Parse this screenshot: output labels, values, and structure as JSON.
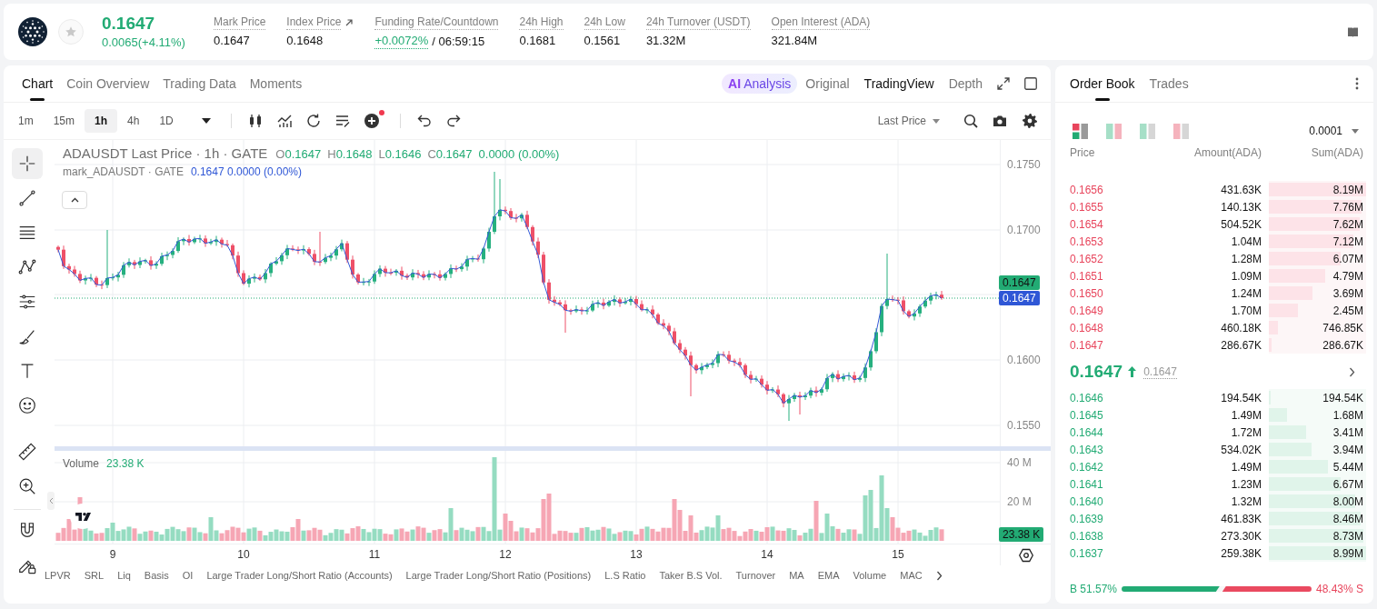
{
  "header": {
    "price": "0.1647",
    "change": "0.0065(+4.11%)",
    "favorite": false,
    "stats": [
      {
        "label": "Mark Price",
        "value": "0.1647",
        "kind": "plain"
      },
      {
        "label": "Index Price",
        "value": "0.1648",
        "kind": "link"
      },
      {
        "label": "Funding Rate/Countdown",
        "value": "+0.0072%",
        "countdown": "/ 06:59:15",
        "kind": "funding"
      },
      {
        "label": "24h High",
        "value": "0.1681",
        "kind": "plain"
      },
      {
        "label": "24h Low",
        "value": "0.1561",
        "kind": "plain"
      },
      {
        "label": "24h Turnover (USDT)",
        "value": "31.32M",
        "kind": "plain"
      },
      {
        "label": "Open Interest (ADA)",
        "value": "321.84M",
        "kind": "plain"
      }
    ]
  },
  "chart_panel": {
    "tabs": [
      {
        "label": "Chart",
        "selected": true
      },
      {
        "label": "Coin Overview",
        "selected": false
      },
      {
        "label": "Trading Data",
        "selected": false
      },
      {
        "label": "Moments",
        "selected": false
      }
    ],
    "views": [
      {
        "badge": "AI",
        "label": "Analysis",
        "kind": "ai",
        "selected": false
      },
      {
        "label": "Original",
        "kind": "plain",
        "selected": false
      },
      {
        "label": "TradingView",
        "kind": "plain",
        "selected": true
      },
      {
        "label": "Depth",
        "kind": "plain",
        "selected": false
      }
    ],
    "intervals": [
      {
        "label": "1m",
        "selected": false
      },
      {
        "label": "15m",
        "selected": false
      },
      {
        "label": "1h",
        "selected": true
      },
      {
        "label": "4h",
        "selected": false
      },
      {
        "label": "1D",
        "selected": false
      }
    ],
    "add_indicator_dot": true,
    "price_source": "Last Price",
    "tool_groups": [
      [
        {
          "kind": "crosshair",
          "selected": true
        },
        {
          "kind": "trend-line",
          "selected": false
        },
        {
          "kind": "horizontal-lines",
          "selected": false
        },
        {
          "kind": "pattern",
          "selected": false
        },
        {
          "kind": "levels",
          "selected": false
        },
        {
          "kind": "brush",
          "selected": false
        },
        {
          "kind": "text",
          "selected": false
        },
        {
          "kind": "emoji",
          "selected": false
        }
      ],
      [
        {
          "kind": "ruler",
          "selected": false
        },
        {
          "kind": "zoom",
          "selected": false
        }
      ],
      [
        {
          "kind": "magnet",
          "selected": false
        },
        {
          "kind": "lock-drawings",
          "selected": false
        }
      ]
    ],
    "legend": {
      "title": "ADAUSDT Last Price · 1h · GATE",
      "ohlc": [
        {
          "key": "O",
          "value": "0.1647"
        },
        {
          "key": "H",
          "value": "0.1648"
        },
        {
          "key": "L",
          "value": "0.1646"
        },
        {
          "key": "C",
          "value": "0.1647"
        }
      ],
      "change": "0.0000 (0.00%)",
      "mark_title": "mark_ADAUSDT · GATE",
      "mark_values": "0.1647 0.0000 (0.00%)"
    },
    "price_axis": [
      "0.1750",
      "0.1700",
      "0.1600",
      "0.1550"
    ],
    "price_tags": [
      {
        "value": "0.1647",
        "kind": "last"
      },
      {
        "value": "0.1647",
        "kind": "mark"
      }
    ],
    "volume": {
      "label": "Volume",
      "value": "23.38 K",
      "axis": [
        "40 M",
        "20 M"
      ],
      "tag": "23.38 K"
    },
    "time_axis": [
      "9",
      "10",
      "11",
      "12",
      "13",
      "14",
      "15"
    ],
    "indicators": [
      "LPVR",
      "SRL",
      "Liq",
      "Basis",
      "OI",
      "Large Trader Long/Short Ratio (Accounts)",
      "Large Trader Long/Short Ratio (Positions)",
      "L.S Ratio",
      "Taker B.S Vol.",
      "Turnover",
      "MA",
      "EMA",
      "Volume",
      "MAC"
    ]
  },
  "order_book": {
    "tabs": [
      {
        "label": "Order Book",
        "selected": true
      },
      {
        "label": "Trades",
        "selected": false
      }
    ],
    "layouts": [
      {
        "kind": "both",
        "selected": true
      },
      {
        "kind": "split",
        "selected": false
      },
      {
        "kind": "bids",
        "selected": false
      },
      {
        "kind": "asks",
        "selected": false
      }
    ],
    "precision": "0.0001",
    "columns": [
      "Price",
      "Amount(ADA)",
      "Sum(ADA)"
    ],
    "asks": [
      {
        "price": "0.1656",
        "amount": "431.63K",
        "sum": "8.19M",
        "level": 1
      },
      {
        "price": "0.1655",
        "amount": "140.13K",
        "sum": "7.76M",
        "level": 0.95
      },
      {
        "price": "0.1654",
        "amount": "504.52K",
        "sum": "7.62M",
        "level": 0.93
      },
      {
        "price": "0.1653",
        "amount": "1.04M",
        "sum": "7.12M",
        "level": 0.87
      },
      {
        "price": "0.1652",
        "amount": "1.28M",
        "sum": "6.07M",
        "level": 0.74
      },
      {
        "price": "0.1651",
        "amount": "1.09M",
        "sum": "4.79M",
        "level": 0.58
      },
      {
        "price": "0.1650",
        "amount": "1.24M",
        "sum": "3.69M",
        "level": 0.45
      },
      {
        "price": "0.1649",
        "amount": "1.70M",
        "sum": "2.45M",
        "level": 0.3
      },
      {
        "price": "0.1648",
        "amount": "460.18K",
        "sum": "746.85K",
        "level": 0.09
      },
      {
        "price": "0.1647",
        "amount": "286.67K",
        "sum": "286.67K",
        "level": 0.03
      }
    ],
    "last_price": "0.1647",
    "rising": true,
    "mark_price": "0.1647",
    "bids": [
      {
        "price": "0.1646",
        "amount": "194.54K",
        "sum": "194.54K",
        "level": 0.02
      },
      {
        "price": "0.1645",
        "amount": "1.49M",
        "sum": "1.68M",
        "level": 0.19
      },
      {
        "price": "0.1644",
        "amount": "1.72M",
        "sum": "3.41M",
        "level": 0.38
      },
      {
        "price": "0.1643",
        "amount": "534.02K",
        "sum": "3.94M",
        "level": 0.44
      },
      {
        "price": "0.1642",
        "amount": "1.49M",
        "sum": "5.44M",
        "level": 0.61
      },
      {
        "price": "0.1641",
        "amount": "1.23M",
        "sum": "6.67M",
        "level": 0.74
      },
      {
        "price": "0.1640",
        "amount": "1.32M",
        "sum": "8.00M",
        "level": 0.89
      },
      {
        "price": "0.1639",
        "amount": "461.83K",
        "sum": "8.46M",
        "level": 0.94
      },
      {
        "price": "0.1638",
        "amount": "273.30K",
        "sum": "8.73M",
        "level": 0.97
      },
      {
        "price": "0.1637",
        "amount": "259.38K",
        "sum": "8.99M",
        "level": 1
      }
    ],
    "ratio": {
      "buy": "B 51.57%",
      "sell": "48.43% S",
      "level": 0.5157
    }
  }
}
